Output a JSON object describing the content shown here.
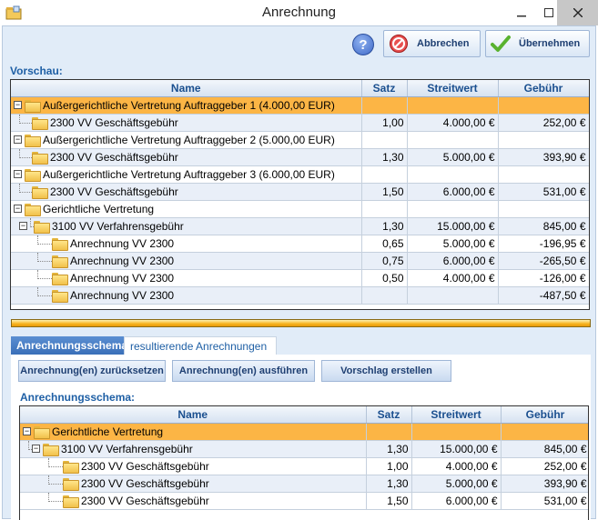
{
  "window": {
    "title": "Anrechnung"
  },
  "toolbar": {
    "cancel_label": "Abbrechen",
    "accept_label": "Übernehmen"
  },
  "preview": {
    "label": "Vorschau:",
    "columns": [
      "Name",
      "Satz",
      "Streitwert",
      "Gebühr"
    ],
    "rows": [
      {
        "name": "Außergerichtliche Vertretung Auftraggeber 1 (4.000,00 EUR)",
        "satz": "",
        "streitwert": "",
        "gebuehr": ""
      },
      {
        "name": "2300 VV Geschäftsgebühr",
        "satz": "1,00",
        "streitwert": "4.000,00 €",
        "gebuehr": "252,00 €"
      },
      {
        "name": "Außergerichtliche Vertretung Auftraggeber 2 (5.000,00 EUR)",
        "satz": "",
        "streitwert": "",
        "gebuehr": ""
      },
      {
        "name": "2300 VV Geschäftsgebühr",
        "satz": "1,30",
        "streitwert": "5.000,00 €",
        "gebuehr": "393,90 €"
      },
      {
        "name": "Außergerichtliche Vertretung Auftraggeber 3 (6.000,00 EUR)",
        "satz": "",
        "streitwert": "",
        "gebuehr": ""
      },
      {
        "name": "2300 VV Geschäftsgebühr",
        "satz": "1,50",
        "streitwert": "6.000,00 €",
        "gebuehr": "531,00 €"
      },
      {
        "name": "Gerichtliche Vertretung",
        "satz": "",
        "streitwert": "",
        "gebuehr": ""
      },
      {
        "name": "3100 VV Verfahrensgebühr",
        "satz": "1,30",
        "streitwert": "15.000,00 €",
        "gebuehr": "845,00 €"
      },
      {
        "name": "Anrechnung VV 2300",
        "satz": "0,65",
        "streitwert": "5.000,00 €",
        "gebuehr": "-196,95 €"
      },
      {
        "name": "Anrechnung VV 2300",
        "satz": "0,75",
        "streitwert": "6.000,00 €",
        "gebuehr": "-265,50 €"
      },
      {
        "name": "Anrechnung VV 2300",
        "satz": "0,50",
        "streitwert": "4.000,00 €",
        "gebuehr": "-126,00 €"
      },
      {
        "name": "Anrechnung VV 2300",
        "satz": "",
        "streitwert": "",
        "gebuehr": "-487,50 €"
      }
    ]
  },
  "tabs": {
    "active": "Anrechnungsschema",
    "inactive": "resultierende Anrechnungen"
  },
  "actions": {
    "reset_label": "Anrechnung(en) zurücksetzen",
    "execute_label": "Anrechnung(en) ausführen",
    "suggest_label": "Vorschlag erstellen"
  },
  "schema": {
    "label": "Anrechnungsschema:",
    "columns": [
      "Name",
      "Satz",
      "Streitwert",
      "Gebühr"
    ],
    "rows": [
      {
        "name": "Gerichtliche Vertretung",
        "satz": "",
        "streitwert": "",
        "gebuehr": ""
      },
      {
        "name": "3100 VV Verfahrensgebühr",
        "satz": "1,30",
        "streitwert": "15.000,00 €",
        "gebuehr": "845,00 €"
      },
      {
        "name": "2300 VV Geschäftsgebühr",
        "satz": "1,00",
        "streitwert": "4.000,00 €",
        "gebuehr": "252,00 €"
      },
      {
        "name": "2300 VV Geschäftsgebühr",
        "satz": "1,30",
        "streitwert": "5.000,00 €",
        "gebuehr": "393,90 €"
      },
      {
        "name": "2300 VV Geschäftsgebühr",
        "satz": "1,50",
        "streitwert": "6.000,00 €",
        "gebuehr": "531,00 €"
      }
    ]
  }
}
